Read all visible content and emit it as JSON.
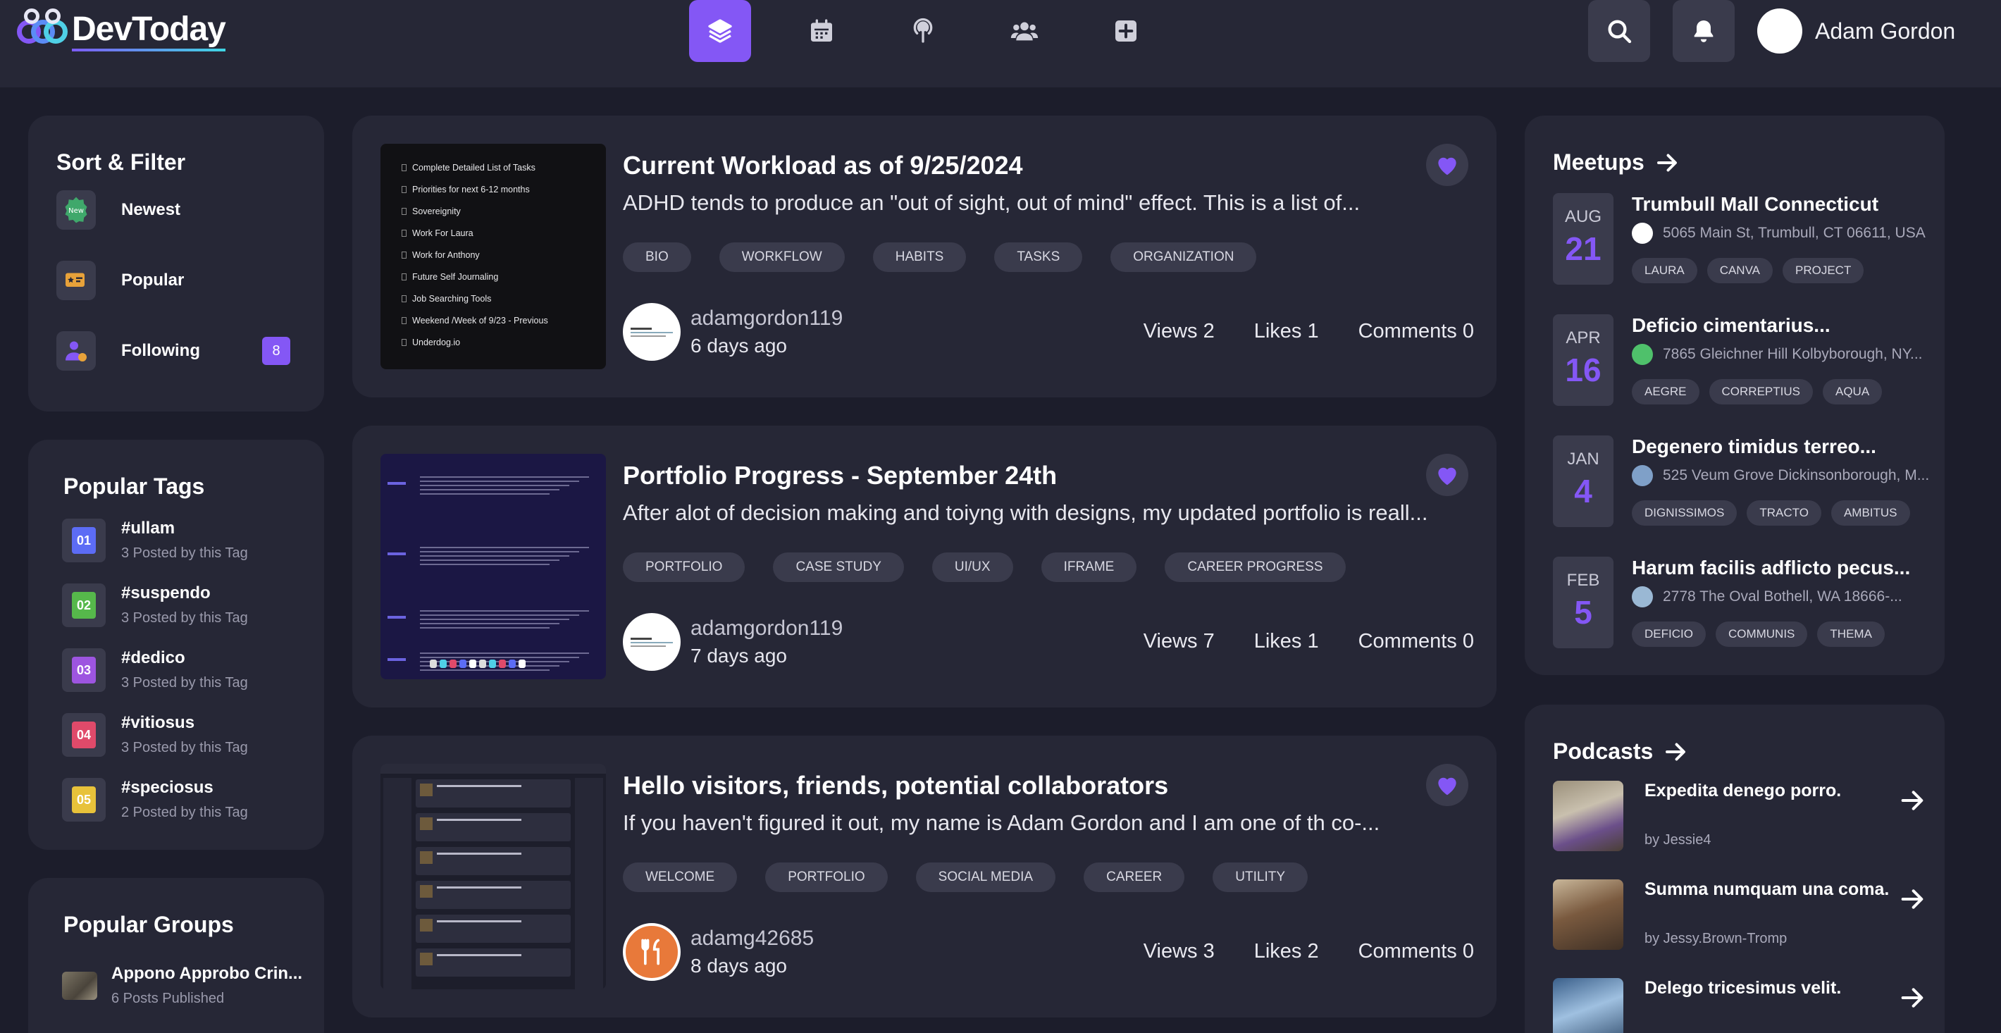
{
  "app": {
    "name": "DevToday"
  },
  "header": {
    "nav": [
      "feed-icon",
      "calendar-icon",
      "podcast-icon",
      "groups-icon",
      "create-icon"
    ],
    "user_name": "Adam Gordon"
  },
  "colors": {
    "accent": "#8457f5",
    "bg": "#1c1d2b",
    "card": "#262736",
    "chip": "#3a3b4c"
  },
  "sort_filter": {
    "title": "Sort & Filter",
    "items": [
      {
        "label": "Newest",
        "icon": "new-badge-icon"
      },
      {
        "label": "Popular",
        "icon": "popular-icon"
      },
      {
        "label": "Following",
        "icon": "following-icon",
        "count": "8"
      }
    ]
  },
  "popular_tags": {
    "title": "Popular Tags",
    "items": [
      {
        "num": "01",
        "name": "#ullam",
        "sub": "3 Posted by this Tag",
        "color": "#5c6cf5"
      },
      {
        "num": "02",
        "name": "#suspendo",
        "sub": "3 Posted by this Tag",
        "color": "#56b84b"
      },
      {
        "num": "03",
        "name": "#dedico",
        "sub": "3 Posted by this Tag",
        "color": "#9d55e0"
      },
      {
        "num": "04",
        "name": "#vitiosus",
        "sub": "3 Posted by this Tag",
        "color": "#e04a6a"
      },
      {
        "num": "05",
        "name": "#speciosus",
        "sub": "2 Posted by this Tag",
        "color": "#e8c23a"
      }
    ]
  },
  "popular_groups": {
    "title": "Popular Groups",
    "items": [
      {
        "name": "Appono Approbo Crin...",
        "sub": "6 Posts Published"
      }
    ]
  },
  "posts": [
    {
      "title": "Current Workload as of 9/25/2024",
      "desc": "ADHD tends to produce an \"out of sight, out of mind\" effect.  This is a list of...",
      "tags": [
        "BIO",
        "WORKFLOW",
        "HABITS",
        "TASKS",
        "ORGANIZATION"
      ],
      "author": "adamgordon119",
      "time": "6 days ago",
      "views": "Views 2",
      "likes": "Likes 1",
      "comments": "Comments 0",
      "thumb_lines": [
        "Complete Detailed List of Tasks",
        "Priorities for next 6-12 months",
        "Sovereignity",
        "Work For Laura",
        "Work for Anthony",
        "Future Self Journaling",
        "Job Searching Tools",
        "Weekend /Week of 9/23 - Previous",
        "Underdog.io"
      ]
    },
    {
      "title": "Portfolio Progress - September 24th",
      "desc": "After alot of decision making and toiyng with designs, my updated portfolio is reall...",
      "tags": [
        "PORTFOLIO",
        "CASE STUDY",
        "UI/UX",
        "IFRAME",
        "CAREER PROGRESS"
      ],
      "author": "adamgordon119",
      "time": "7 days ago",
      "views": "Views 7",
      "likes": "Likes 1",
      "comments": "Comments 0"
    },
    {
      "title": "Hello visitors, friends, potential collaborators",
      "desc": "If you haven't figured it out, my name is Adam Gordon and I am one of th co-...",
      "tags": [
        "WELCOME",
        "PORTFOLIO",
        "SOCIAL MEDIA",
        "CAREER",
        "UTILITY"
      ],
      "author": "adamg42685",
      "time": "8 days ago",
      "views": "Views 3",
      "likes": "Likes 2",
      "comments": "Comments 0"
    }
  ],
  "meetups": {
    "title": "Meetups",
    "items": [
      {
        "month": "AUG",
        "day": "21",
        "title": "Trumbull Mall Connecticut",
        "addr": "5065 Main St, Trumbull, CT 06611, USA",
        "tags": [
          "LAURA",
          "CANVA",
          "PROJECT"
        ]
      },
      {
        "month": "APR",
        "day": "16",
        "title": "Deficio cimentarius...",
        "addr": "7865 Gleichner Hill Kolbyborough, NY...",
        "tags": [
          "AEGRE",
          "CORREPTIUS",
          "AQUA"
        ]
      },
      {
        "month": "JAN",
        "day": "4",
        "title": "Degenero timidus terreo...",
        "addr": "525 Veum Grove Dickinsonborough, M...",
        "tags": [
          "DIGNISSIMOS",
          "TRACTO",
          "AMBITUS"
        ]
      },
      {
        "month": "FEB",
        "day": "5",
        "title": "Harum facilis adflicto pecus...",
        "addr": "2778 The Oval Bothell, WA 18666-...",
        "tags": [
          "DEFICIO",
          "COMMUNIS",
          "THEMA"
        ]
      }
    ]
  },
  "podcasts": {
    "title": "Podcasts",
    "items": [
      {
        "title": "Expedita denego porro.",
        "by": "by Jessie4"
      },
      {
        "title": "Summa numquam una coma.",
        "by": "by Jessy.Brown-Tromp"
      },
      {
        "title": "Delego tricesimus velit.",
        "by": ""
      }
    ]
  }
}
